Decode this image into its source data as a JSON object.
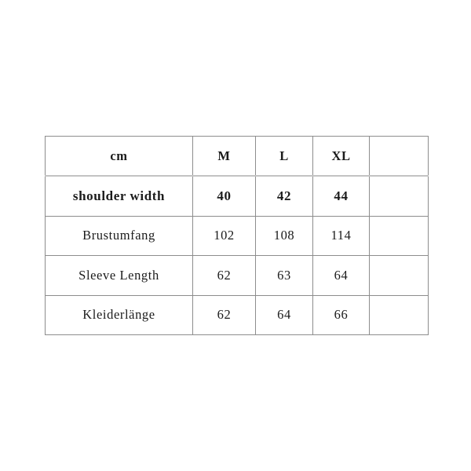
{
  "page": {
    "background_color": "#ffffff",
    "border_color": "#8d8d8d",
    "header_rule_color": "#c3c3c3",
    "text_color": "#1b1b1b"
  },
  "size_chart": {
    "unit_label": "cm",
    "columns": [
      "cm",
      "M",
      "L",
      "XL",
      ""
    ],
    "rows": [
      {
        "label": "shoulder width",
        "bold": true,
        "values": [
          "40",
          "42",
          "44",
          ""
        ]
      },
      {
        "label": "Brustumfang",
        "bold": false,
        "values": [
          "102",
          "108",
          "114",
          ""
        ]
      },
      {
        "label": "Sleeve Length",
        "bold": false,
        "values": [
          "62",
          "63",
          "64",
          ""
        ]
      },
      {
        "label": "Kleiderlänge",
        "bold": false,
        "values": [
          "62",
          "64",
          "66",
          ""
        ]
      }
    ]
  },
  "chart_data": {
    "type": "table",
    "title": "cm",
    "categories": [
      "M",
      "L",
      "XL"
    ],
    "series": [
      {
        "name": "shoulder width",
        "values": [
          40,
          42,
          44
        ]
      },
      {
        "name": "Brustumfang",
        "values": [
          102,
          108,
          114
        ]
      },
      {
        "name": "Sleeve Length",
        "values": [
          62,
          63,
          64
        ]
      },
      {
        "name": "Kleiderlänge",
        "values": [
          62,
          64,
          66
        ]
      }
    ],
    "xlabel": "",
    "ylabel": "cm"
  }
}
